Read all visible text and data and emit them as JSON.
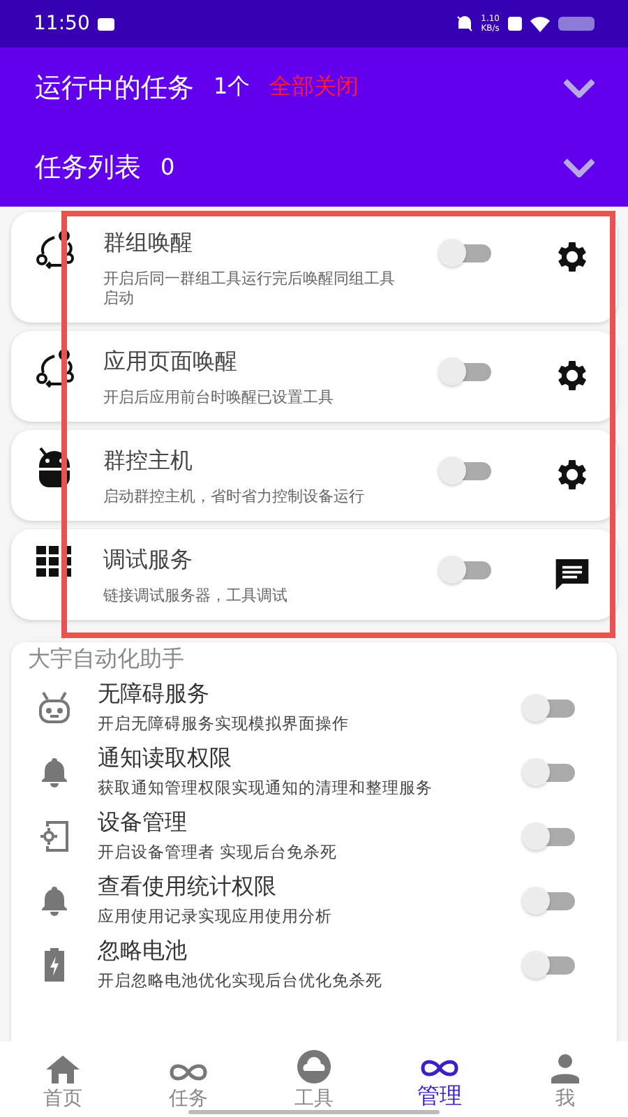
{
  "status_bar": {
    "time": "11:50",
    "net_speed_value": "1.10",
    "net_speed_unit": "KB/s"
  },
  "header": {
    "running": {
      "title": "运行中的任务",
      "count": "1个",
      "action": "全部关闭",
      "expanded": false
    },
    "task_list": {
      "title": "任务列表",
      "count": "0",
      "expanded": false
    }
  },
  "tools": [
    {
      "kind": "cycle",
      "title": "群组唤醒",
      "desc": "开启后同一群组工具运行完后唤醒同组工具启动",
      "on": false
    },
    {
      "kind": "cycle",
      "title": "应用页面唤醒",
      "desc": "开启后应用前台时唤醒已设置工具",
      "on": false
    },
    {
      "kind": "android",
      "title": "群控主机",
      "desc": "启动群控主机，省时省力控制设备运行",
      "on": false
    },
    {
      "kind": "grid",
      "title": "调试服务",
      "desc": "链接调试服务器，工具调试",
      "on": false
    }
  ],
  "permissions": {
    "title": "大宇自动化助手",
    "items": [
      {
        "kind": "robot",
        "title": "无障碍服务",
        "desc": "开启无障碍服务实现模拟界面操作",
        "on": false
      },
      {
        "kind": "bell",
        "title": "通知读取权限",
        "desc": "获取通知管理权限实现通知的清理和整理服务",
        "on": false
      },
      {
        "kind": "device",
        "title": "设备管理",
        "desc": "开启设备管理者 实现后台免杀死",
        "on": false
      },
      {
        "kind": "bell",
        "title": "查看使用统计权限",
        "desc": "应用使用记录实现应用使用分析",
        "on": false
      },
      {
        "kind": "battery",
        "title": "忽略电池",
        "desc": "开启忽略电池优化实现后台优化免杀死",
        "on": false
      }
    ]
  },
  "bottom_nav": [
    {
      "kind": "home",
      "label": "首页",
      "selected": false
    },
    {
      "kind": "loop",
      "label": "任务",
      "selected": false
    },
    {
      "kind": "cloud",
      "label": "工具",
      "selected": false
    },
    {
      "kind": "loop",
      "label": "管理",
      "selected": true
    },
    {
      "kind": "person",
      "label": "我",
      "selected": false
    }
  ]
}
